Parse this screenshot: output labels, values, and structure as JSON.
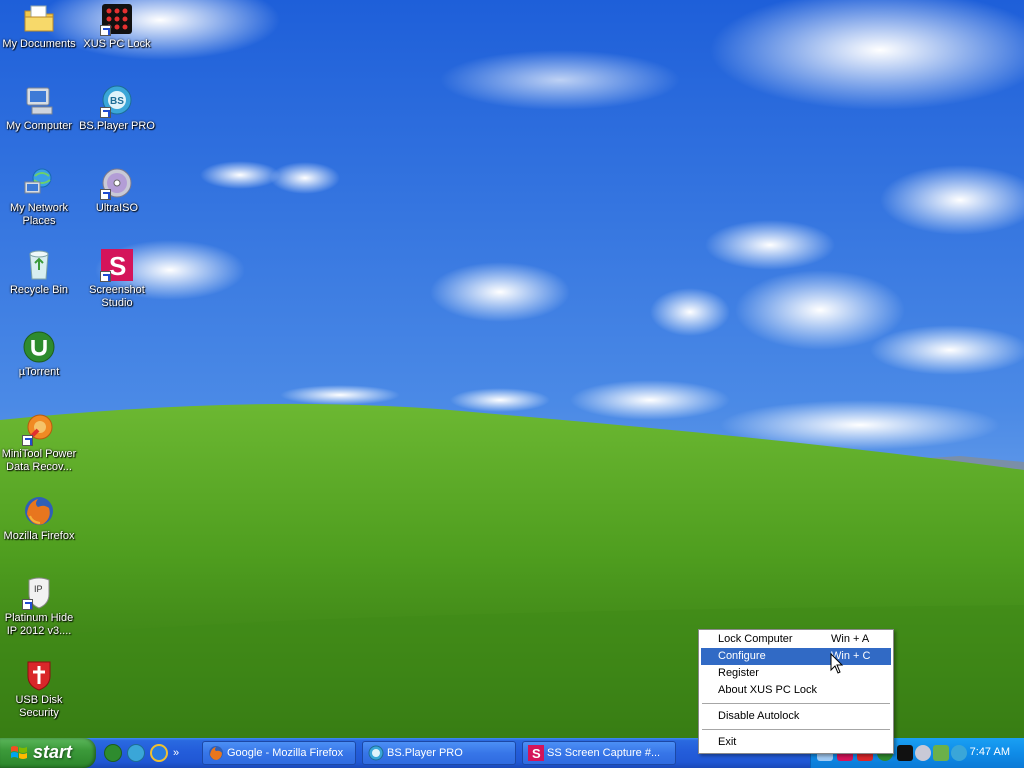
{
  "desktop": {
    "icons": [
      {
        "label": "My Documents",
        "icon": "folder-icon"
      },
      {
        "label": "XUS PC Lock",
        "icon": "dice-lock-icon"
      },
      {
        "label": "My Computer",
        "icon": "computer-icon"
      },
      {
        "label": "BS.Player PRO",
        "icon": "bs-player-icon"
      },
      {
        "label": "My Network\nPlaces",
        "icon": "network-icon"
      },
      {
        "label": "UltraISO",
        "icon": "disc-icon"
      },
      {
        "label": "Recycle Bin",
        "icon": "recycle-bin-icon"
      },
      {
        "label": "Screenshot\nStudio",
        "icon": "screenshot-studio-icon"
      },
      {
        "label": "µTorrent",
        "icon": "utorrent-icon"
      },
      {
        "label": "MiniTool Power\nData Recov...",
        "icon": "minitool-icon"
      },
      {
        "label": "Mozilla Firefox",
        "icon": "firefox-icon"
      },
      {
        "label": "Platinum Hide\nIP 2012 v3....",
        "icon": "hide-ip-icon"
      },
      {
        "label": "USB Disk\nSecurity",
        "icon": "usb-shield-icon"
      }
    ]
  },
  "taskbar": {
    "start_label": "start",
    "quick_launch_more": "»",
    "tasks": [
      {
        "label": "Google - Mozilla Firefox",
        "icon": "firefox-icon"
      },
      {
        "label": "BS.Player PRO",
        "icon": "bs-player-icon"
      },
      {
        "label": "SS Screen Capture #...",
        "icon": "screenshot-studio-icon"
      }
    ],
    "clock": "7:47 AM"
  },
  "context_menu": {
    "items": [
      {
        "label": "Lock Computer",
        "shortcut": "Win + A"
      },
      {
        "label": "Configure",
        "shortcut": "Win + C",
        "selected": true
      },
      {
        "label": "Register",
        "shortcut": ""
      },
      {
        "label": "About XUS PC Lock",
        "shortcut": ""
      },
      {
        "label": "Disable Autolock",
        "shortcut": ""
      },
      {
        "label": "Exit",
        "shortcut": ""
      }
    ]
  },
  "colors": {
    "sky": "#3a6fd8",
    "grass": "#4f9e1f",
    "taskbar": "#245edb",
    "start": "#3c9a3a",
    "tray": "#0f8ce8",
    "menu_highlight": "#316ac5"
  }
}
